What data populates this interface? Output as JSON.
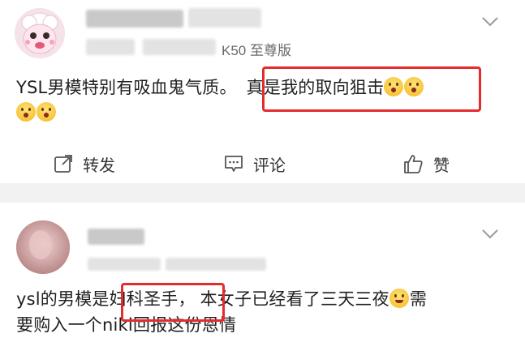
{
  "post1": {
    "username": "",
    "device_suffix": "K50 至尊版",
    "content_plain": "YSL男模特别有吸血鬼气质。",
    "content_highlight": "真是我的取向狙击",
    "actions": {
      "repost": "转发",
      "comment": "评论",
      "like": "赞"
    },
    "icons": {
      "repost": "repost-icon",
      "comment": "comment-icon",
      "like": "thumbs-up-icon",
      "emoji": "scream-emoji-icon",
      "menu": "chevron-down-icon"
    },
    "highlight_color": "#e52b2b"
  },
  "post2": {
    "content_prefix": "ysl的男模是",
    "content_highlight": "妇科圣手，",
    "content_suffix": "本女子已经看了三天三夜",
    "content_line2_after_emoji": "需",
    "content_line2": "要购入一个niki回报这份恩情",
    "icons": {
      "emoji": "grin-emoji-icon",
      "menu": "chevron-down-icon"
    }
  }
}
